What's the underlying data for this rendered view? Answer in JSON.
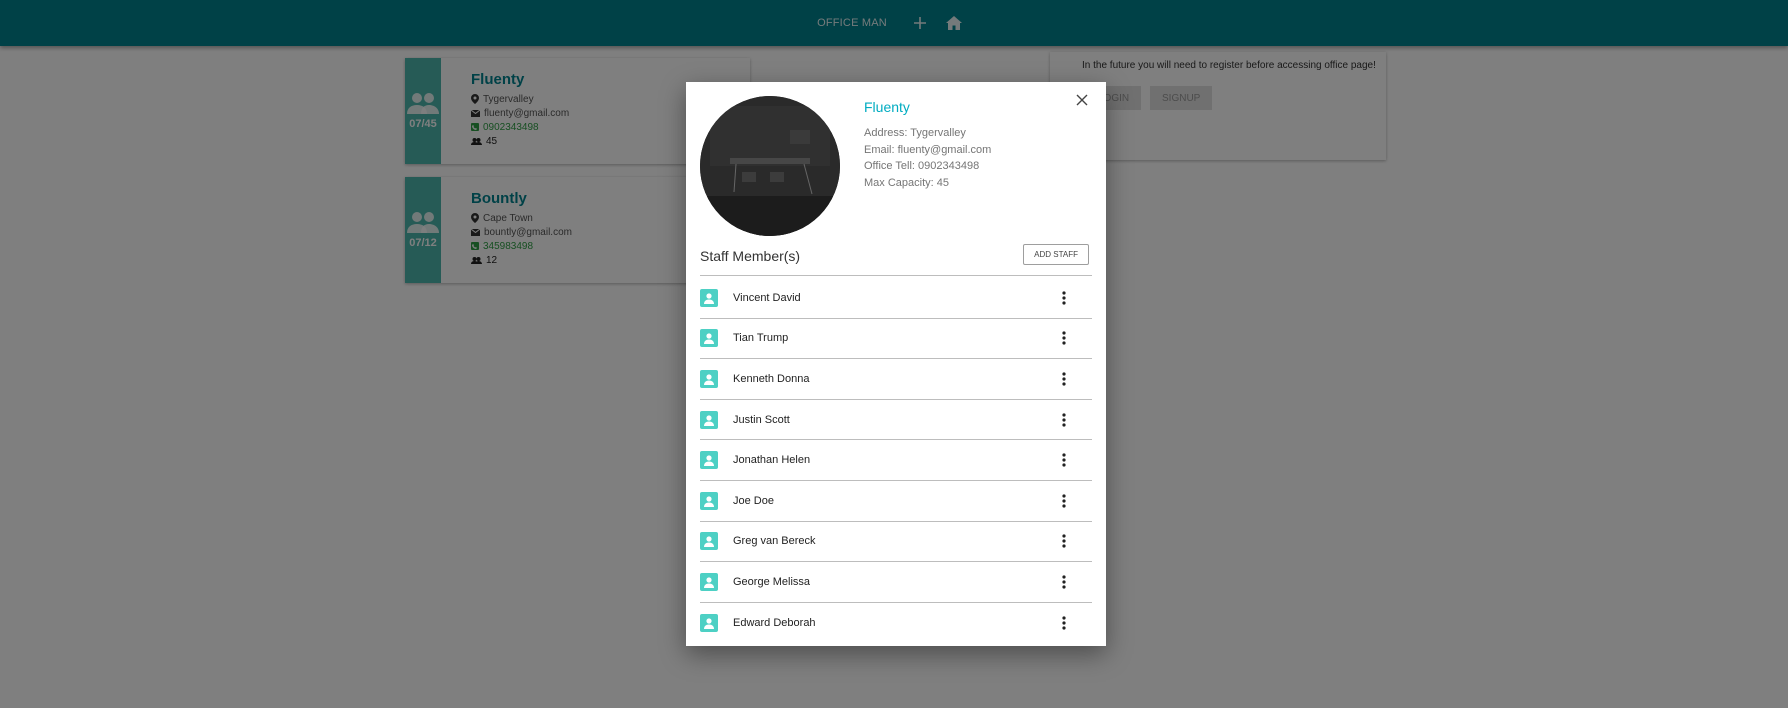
{
  "app": {
    "brand": "OFFICE MAN",
    "add_icon": "plus-icon",
    "home_icon": "home-icon"
  },
  "offices": [
    {
      "name": "Fluenty",
      "address": "Tygervalley",
      "email": "fluenty@gmail.com",
      "tel": "0902343498",
      "capacity": "45",
      "occupancy": "07/45"
    },
    {
      "name": "Bountly",
      "address": "Cape Town",
      "email": "bountly@gmail.com",
      "tel": "345983498",
      "capacity": "12",
      "occupancy": "07/12"
    }
  ],
  "login_panel": {
    "message": "In the future you will need to register before accessing office page!",
    "login_label": "LOGIN",
    "signup_label": "SIGNUP"
  },
  "modal": {
    "office_name": "Fluenty",
    "address_line": "Address: Tygervalley",
    "email_line": "Email: fluenty@gmail.com",
    "tel_line": "Office Tell: 0902343498",
    "capacity_line": "Max Capacity: 45",
    "staff_heading": "Staff Member(s)",
    "add_staff_label": "ADD STAFF",
    "staff": [
      {
        "name": "Vincent David"
      },
      {
        "name": "Tian Trump"
      },
      {
        "name": "Kenneth Donna"
      },
      {
        "name": "Justin Scott"
      },
      {
        "name": "Jonathan Helen"
      },
      {
        "name": "Joe Doe"
      },
      {
        "name": "Greg van Bereck"
      },
      {
        "name": "George Melissa"
      },
      {
        "name": "Edward Deborah"
      }
    ]
  },
  "colors": {
    "primary": "#00838f",
    "accent": "#4db6ac",
    "title": "#00acc1",
    "tel": "#2e9e44"
  }
}
